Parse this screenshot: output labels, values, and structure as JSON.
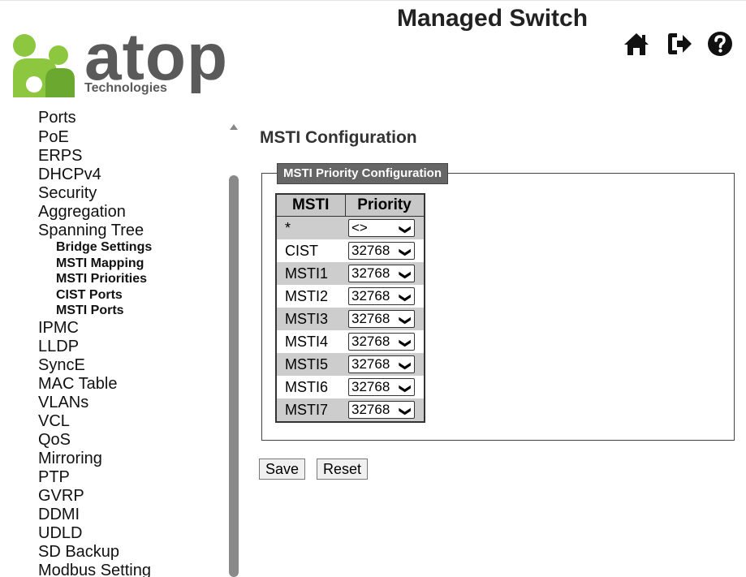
{
  "header": {
    "app_title": "Managed Switch",
    "logo_text": "atop",
    "logo_subtitle": "Technologies",
    "icons": [
      "home-icon",
      "logout-icon",
      "help-icon"
    ]
  },
  "sidebar": {
    "items": [
      "Ports",
      "PoE",
      "ERPS",
      "DHCPv4",
      "Security",
      "Aggregation",
      "Spanning Tree"
    ],
    "sub_items": [
      "Bridge Settings",
      "MSTI Mapping",
      "MSTI Priorities",
      "CIST Ports",
      "MSTI Ports"
    ],
    "items_after": [
      "IPMC",
      "LLDP",
      "SyncE",
      "MAC Table",
      "VLANs",
      "VCL",
      "QoS",
      "Mirroring",
      "PTP",
      "GVRP",
      "DDMI",
      "UDLD",
      "SD Backup",
      "Modbus Setting"
    ]
  },
  "main": {
    "title": "MSTI Configuration",
    "legend": "MSTI Priority Configuration",
    "columns": [
      "MSTI",
      "Priority"
    ],
    "rows": [
      {
        "name": "*",
        "priority": "<>"
      },
      {
        "name": "CIST",
        "priority": "32768"
      },
      {
        "name": "MSTI1",
        "priority": "32768"
      },
      {
        "name": "MSTI2",
        "priority": "32768"
      },
      {
        "name": "MSTI3",
        "priority": "32768"
      },
      {
        "name": "MSTI4",
        "priority": "32768"
      },
      {
        "name": "MSTI5",
        "priority": "32768"
      },
      {
        "name": "MSTI6",
        "priority": "32768"
      },
      {
        "name": "MSTI7",
        "priority": "32768"
      }
    ],
    "save_label": "Save",
    "reset_label": "Reset"
  },
  "colors": {
    "logo_green": "#8dc63f",
    "logo_gray": "#5a5a5a",
    "header_bg": "#c8c8c8",
    "row_shade": "#cdcdcd",
    "legend_bg": "#666666"
  }
}
